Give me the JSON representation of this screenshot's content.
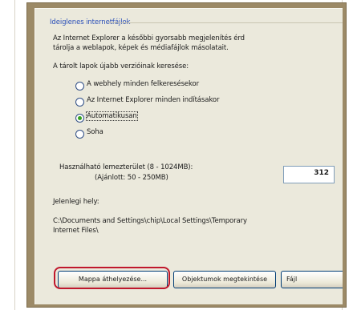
{
  "group_title": "Ideiglenes internetfájlok",
  "intro_text": [
    "Az Internet Explorer a későbbi gyorsabb megjelenítés érd",
    "tárolja a weblapok, képek és médiafájlok másolatait."
  ],
  "check_heading": "A tárolt lapok újabb verzióinak keresése:",
  "options": [
    {
      "label": "A webhely minden felkeresésekor",
      "selected": false
    },
    {
      "label": "Az Internet Explorer minden indításakor",
      "selected": false
    },
    {
      "label": "Automatikusan",
      "selected": true
    },
    {
      "label": "Soha",
      "selected": false
    }
  ],
  "disk_space": {
    "label": "Használható lemezterület (8 - 1024MB):",
    "recommended": "(Ajánlott: 50 - 250MB)",
    "value": "312"
  },
  "location": {
    "label": "Jelenlegi hely:",
    "path_line1": "C:\\Documents and Settings\\chip\\Local Settings\\Temporary",
    "path_line2": "Internet Files\\"
  },
  "buttons": {
    "move_folder": "Mappa áthelyezése...",
    "view_objects": "Objektumok megtekintése",
    "view_files": "Fájl"
  },
  "colors": {
    "highlight_outline": "#c0182c",
    "radio_selected": "#36a020",
    "group_title": "#2a4fb8"
  }
}
